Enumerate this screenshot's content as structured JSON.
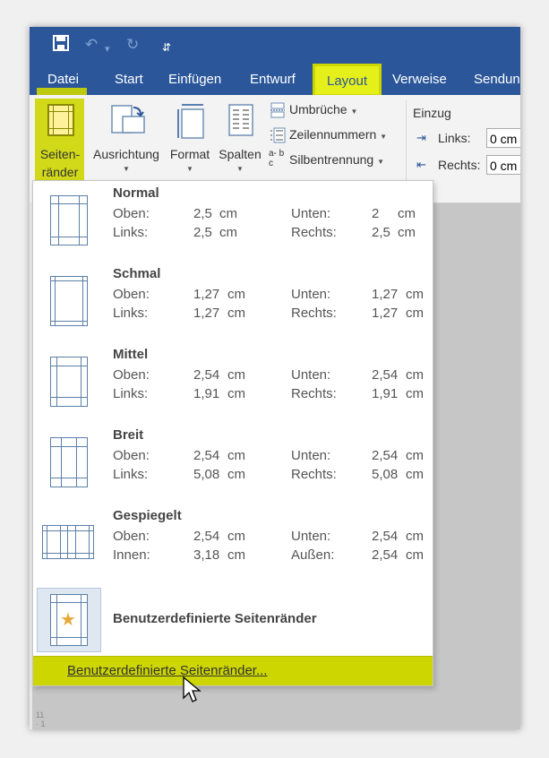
{
  "qat": {
    "save_icon": "save-icon",
    "undo_icon": "undo-icon",
    "redo_icon": "redo-icon",
    "customize_icon": "customize-qat-icon"
  },
  "tabs": [
    {
      "label": "Datei"
    },
    {
      "label": "Start"
    },
    {
      "label": "Einfügen"
    },
    {
      "label": "Entwurf"
    },
    {
      "label": "Layout"
    },
    {
      "label": "Verweise"
    },
    {
      "label": "Sendun"
    }
  ],
  "ribbon": {
    "margins_label_1": "Seiten-",
    "margins_label_2": "ränder",
    "orientation_label": "Ausrichtung",
    "format_label": "Format",
    "columns_label": "Spalten",
    "breaks_label": "Umbrüche",
    "line_numbers_label": "Zeilennummern",
    "hyphenation_label": "Silbentrennung",
    "hyphenation_icon_text": "a- bc",
    "indent_title": "Einzug",
    "indent_left_label": "Links:",
    "indent_left_value": "0  cm",
    "indent_right_label": "Rechts:",
    "indent_right_value": "0  cm"
  },
  "menu": {
    "presets": [
      {
        "name": "Normal",
        "top_label": "Oben:",
        "top": "2,5",
        "bottom_label": "Unten:",
        "bottom": "2",
        "left_label": "Links:",
        "left": "2,5",
        "right_label": "Rechts:",
        "right": "2,5",
        "unit": "cm"
      },
      {
        "name": "Schmal",
        "top_label": "Oben:",
        "top": "1,27",
        "bottom_label": "Unten:",
        "bottom": "1,27",
        "left_label": "Links:",
        "left": "1,27",
        "right_label": "Rechts:",
        "right": "1,27",
        "unit": "cm"
      },
      {
        "name": "Mittel",
        "top_label": "Oben:",
        "top": "2,54",
        "bottom_label": "Unten:",
        "bottom": "2,54",
        "left_label": "Links:",
        "left": "1,91",
        "right_label": "Rechts:",
        "right": "1,91",
        "unit": "cm"
      },
      {
        "name": "Breit",
        "top_label": "Oben:",
        "top": "2,54",
        "bottom_label": "Unten:",
        "bottom": "2,54",
        "left_label": "Links:",
        "left": "5,08",
        "right_label": "Rechts:",
        "right": "5,08",
        "unit": "cm"
      },
      {
        "name": "Gespiegelt",
        "top_label": "Oben:",
        "top": "2,54",
        "bottom_label": "Unten:",
        "bottom": "2,54",
        "left_label": "Innen:",
        "left": "3,18",
        "right_label": "Außen:",
        "right": "2,54",
        "unit": "cm"
      }
    ],
    "custom_preset_label": "Benutzerdefinierte Seitenränder",
    "custom_margins_command": "Benutzerdefinierte Seitenränder..."
  },
  "ruler_text": "11 · 1",
  "colors": {
    "ribbon_blue": "#2b579a",
    "highlight": "#e5ef1a",
    "margin_line": "#5b7fa8"
  }
}
